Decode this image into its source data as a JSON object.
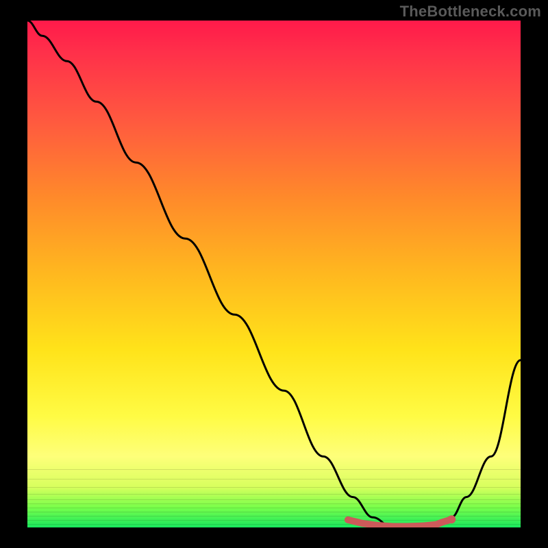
{
  "watermark": "TheBottleneck.com",
  "colors": {
    "trough": "#cc5a5a",
    "curve": "#000000"
  },
  "chart_data": {
    "type": "line",
    "title": "",
    "xlabel": "",
    "ylabel": "",
    "xlim": [
      0,
      100
    ],
    "ylim": [
      0,
      100
    ],
    "grid": false,
    "legend": false,
    "series": [
      {
        "name": "bottleneck-curve",
        "x": [
          0,
          3,
          8,
          14,
          22,
          32,
          42,
          52,
          60,
          66,
          70,
          74,
          78,
          82,
          86,
          89,
          94,
          100
        ],
        "y": [
          100,
          97,
          92,
          84,
          72,
          57,
          42,
          27,
          14,
          6,
          2,
          0,
          0,
          0,
          2,
          6,
          14,
          33
        ]
      }
    ],
    "trough_region": {
      "x_start": 65,
      "x_end": 86,
      "y": 0
    },
    "trough_dots": {
      "x": [
        65,
        68,
        71,
        74,
        77,
        80,
        83,
        84,
        86
      ],
      "y": [
        1.5,
        0.8,
        0.4,
        0.2,
        0.2,
        0.3,
        0.6,
        1.0,
        1.6
      ]
    }
  }
}
